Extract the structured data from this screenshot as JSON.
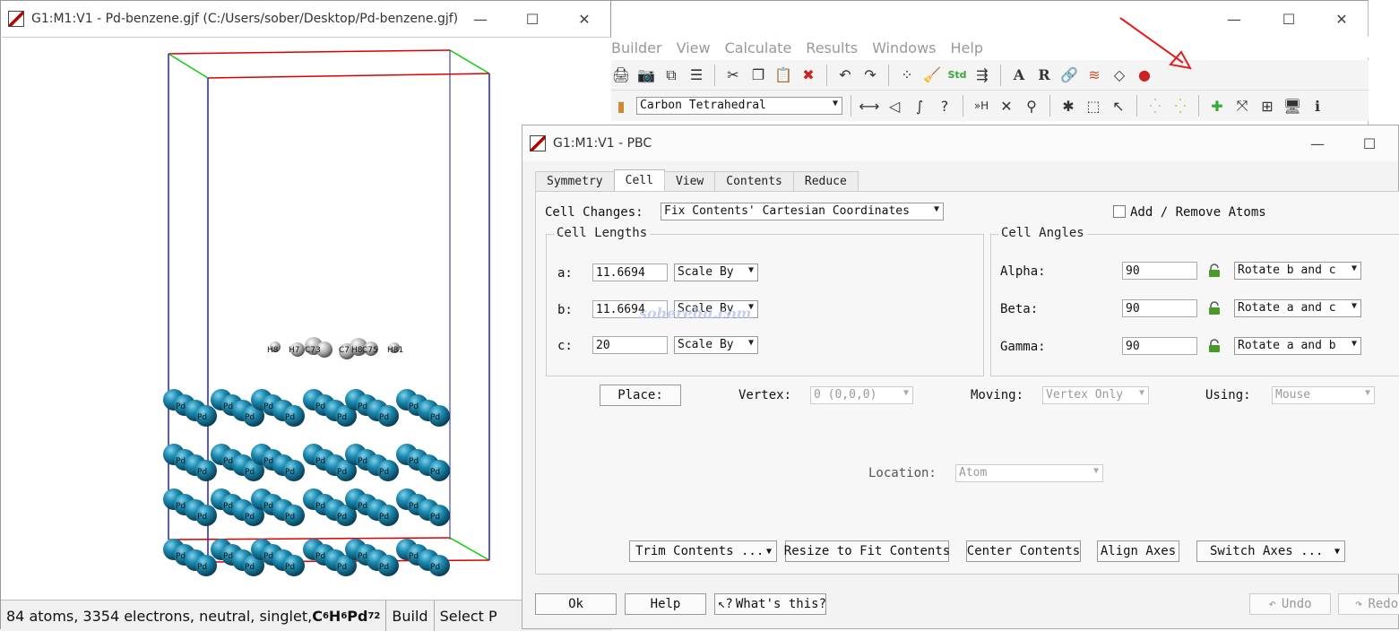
{
  "viewer": {
    "title": "G1:M1:V1 - Pd-benzene.gjf (C:/Users/sober/Desktop/Pd-benzene.gjf)",
    "status": {
      "summary": "84 atoms, 3354 electrons, neutral, singlet, ",
      "formula_c": "C",
      "formula_c_n": "6",
      "formula_h": "H",
      "formula_h_n": "6",
      "formula_pd": "Pd",
      "formula_pd_n": "72",
      "mode_build": "Build",
      "mode_select": "Select P"
    },
    "molecule_labels": [
      "H8",
      "H7",
      "C73",
      "C7",
      "H8",
      "C75",
      "H81"
    ]
  },
  "main": {
    "menu": [
      "Builder",
      "View",
      "Calculate",
      "Results",
      "Windows",
      "Help"
    ],
    "atom_combo": "Carbon Tetrahedral",
    "colors": {
      "arrow": "#e02020"
    }
  },
  "pbc": {
    "title": "G1:M1:V1 - PBC",
    "tabs": [
      "Symmetry",
      "Cell",
      "View",
      "Contents",
      "Reduce"
    ],
    "active_tab": "Cell",
    "cell_changes_label": "Cell Changes:",
    "cell_changes_value": "Fix Contents' Cartesian Coordinates",
    "add_remove_label": "Add / Remove Atoms",
    "lengths": {
      "title": "Cell Lengths",
      "a_label": "a:",
      "a_value": "11.6694",
      "a_mode": "Scale By",
      "b_label": "b:",
      "b_value": "11.6694",
      "b_mode": "Scale By",
      "c_label": "c:",
      "c_value": "20",
      "c_mode": "Scale By"
    },
    "angles": {
      "title": "Cell Angles",
      "alpha_label": "Alpha:",
      "alpha_value": "90",
      "alpha_mode": "Rotate b and c",
      "beta_label": "Beta:",
      "beta_value": "90",
      "beta_mode": "Rotate a and c",
      "gamma_label": "Gamma:",
      "gamma_value": "90",
      "gamma_mode": "Rotate a and b"
    },
    "place_button": "Place:",
    "vertex_label": "Vertex:",
    "vertex_value": "0 (0,0,0)",
    "moving_label": "Moving:",
    "moving_value": "Vertex Only",
    "using_label": "Using:",
    "using_value": "Mouse",
    "location_label": "Location:",
    "location_value": "Atom",
    "actions": {
      "trim": "Trim Contents ...",
      "resize": "Resize to Fit Contents",
      "center": "Center Contents",
      "align": "Align Axes",
      "switch": "Switch Axes ..."
    },
    "footer": {
      "ok": "Ok",
      "help": "Help",
      "whats_this": "What's this?",
      "undo": "Undo",
      "redo": "Redo"
    },
    "watermark": "soberebu.com"
  }
}
